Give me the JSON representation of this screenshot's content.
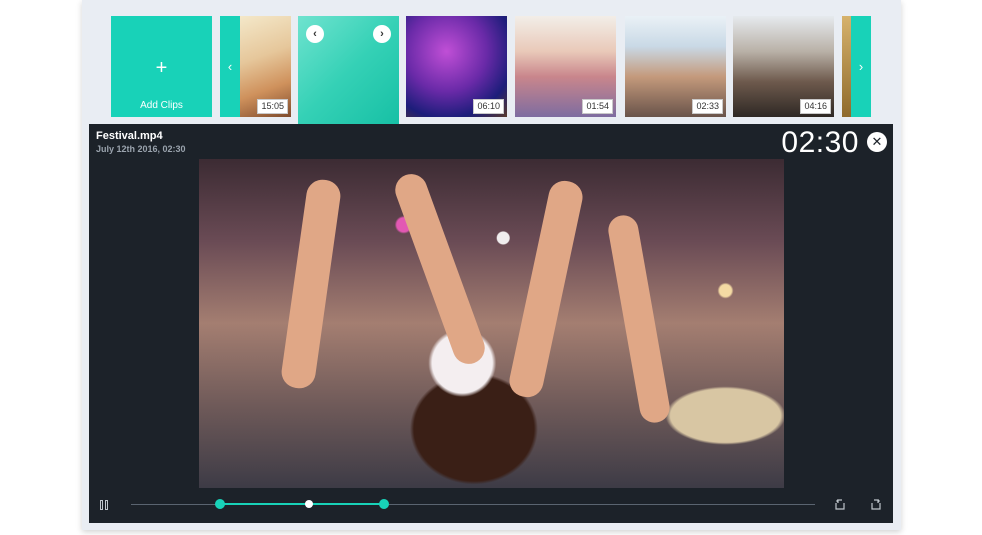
{
  "clip_strip": {
    "add_clips_symbol": "+",
    "add_clips_label": "Add Clips",
    "nav_left_symbol": "‹",
    "nav_right_symbol": "›",
    "thumb_prev_symbol": "‹",
    "thumb_next_symbol": "›",
    "clips": [
      {
        "duration": "15:05"
      },
      {
        "duration": ""
      },
      {
        "duration": "06:10"
      },
      {
        "duration": "01:54"
      },
      {
        "duration": "02:33"
      },
      {
        "duration": "04:16"
      }
    ]
  },
  "player": {
    "file_name": "Festival.mp4",
    "file_date": "July 12th 2016, 02:30",
    "timer": "02:30",
    "close_symbol": "✕",
    "timeline": {
      "start_fraction": 0.13,
      "playhead_fraction": 0.26,
      "end_fraction": 0.37
    }
  },
  "colors": {
    "accent": "#18d2b8",
    "player_bg": "#1c2229"
  }
}
